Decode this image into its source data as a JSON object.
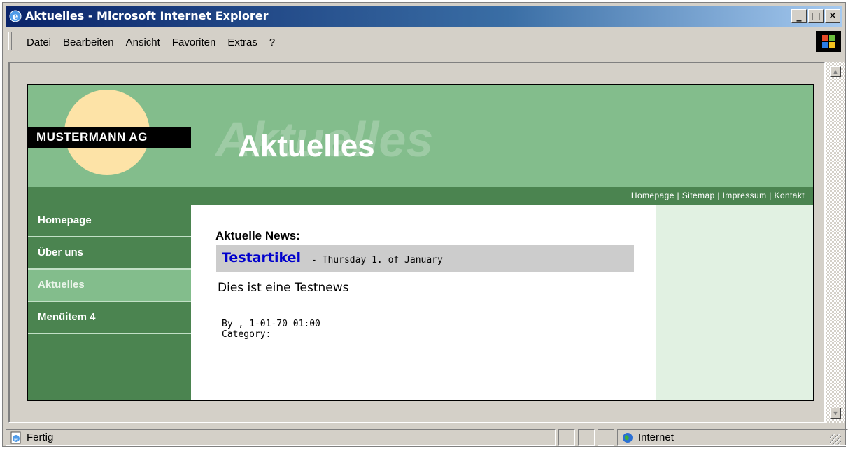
{
  "window": {
    "title": "Aktuelles - Microsoft Internet Explorer",
    "controls": [
      "_",
      "□",
      "✕"
    ]
  },
  "menu": {
    "items": [
      "Datei",
      "Bearbeiten",
      "Ansicht",
      "Favoriten",
      "Extras",
      "?"
    ]
  },
  "site": {
    "company": "MUSTERMANN AG",
    "page_title": "Aktuelles",
    "ghost_title": "Aktuelles",
    "top_links": "Homepage | Sitemap | Impressum | Kontakt",
    "nav": [
      "Homepage",
      "Über uns",
      "Aktuelles",
      "Menüitem 4"
    ],
    "news": {
      "heading": "Aktuelle News:",
      "link": "Testartikel",
      "date": "- Thursday 1. of January",
      "body": "Dies ist eine Testnews",
      "byline": "By , 1-01-70 01:00",
      "category": "Category:"
    },
    "colors": {
      "header": "#83bd8c",
      "dark_green": "#4b8450",
      "light_green": "#e1f1e2",
      "sun": "#fde3a7"
    }
  },
  "status": {
    "text": "Fertig",
    "zone": "Internet"
  }
}
